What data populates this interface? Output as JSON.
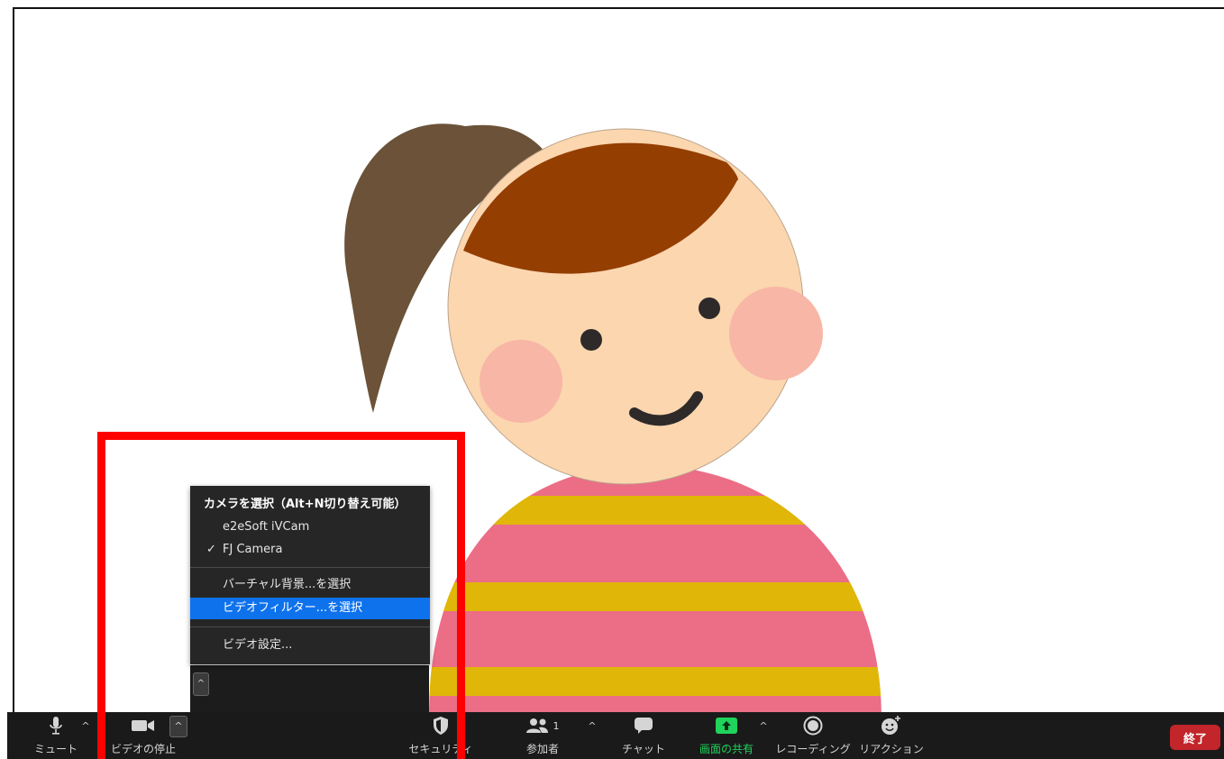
{
  "colors": {
    "toolbar_bg": "#1a1a1a",
    "menu_bg": "#262626",
    "menu_highlight": "#0e72ed",
    "end_button": "#c2252a",
    "share_green": "#1fd35b",
    "annotation_red": "#ff0000"
  },
  "camera_menu": {
    "heading": "カメラを選択（Alt+N切り替え可能）",
    "cameras": [
      {
        "label": "e2eSoft iVCam",
        "checked": false
      },
      {
        "label": "FJ Camera",
        "checked": true,
        "check_mark": "✓"
      }
    ],
    "virtual_background": "バーチャル背景...を選択",
    "video_filter": "ビデオフィルター...を選択",
    "video_settings": "ビデオ設定..."
  },
  "toolbar": {
    "mute_label": "ミュート",
    "stop_video_label": "ビデオの停止",
    "security_label": "セキュリティ",
    "participants_label": "参加者",
    "participants_count": "1",
    "chat_label": "チャット",
    "share_screen_label": "画面の共有",
    "recording_label": "レコーディング",
    "reactions_label": "リアクション",
    "end_label": "終了",
    "icons": {
      "mute": "microphone-icon",
      "video": "video-camera-icon",
      "security": "shield-icon",
      "participants": "people-icon",
      "chat": "chat-bubble-icon",
      "share": "share-arrow-icon",
      "record": "record-icon",
      "reactions": "smiley-plus-icon",
      "caret": "chevron-up-icon"
    }
  }
}
